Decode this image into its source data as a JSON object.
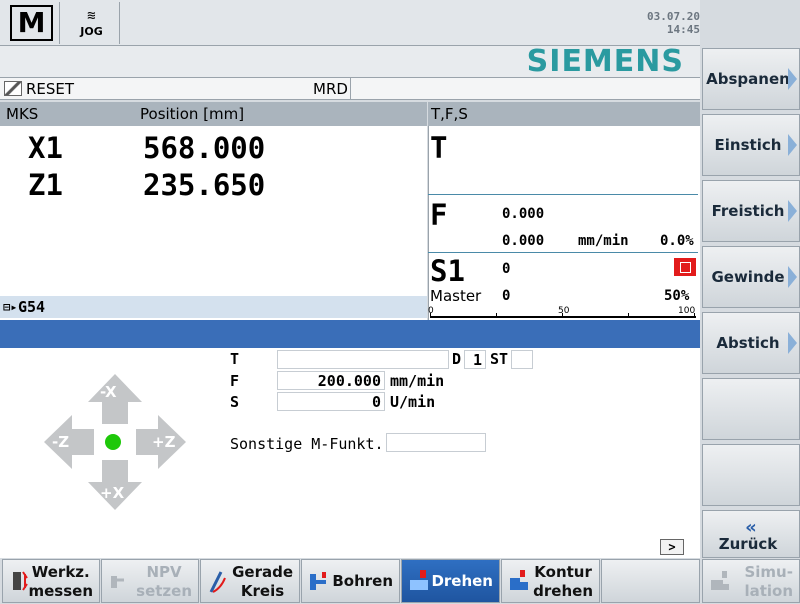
{
  "header": {
    "mode_icon": "M",
    "jog_label": "JOG",
    "date": "03.07.20",
    "time": "14:45",
    "brand": "SIEMENS"
  },
  "status": {
    "reset": "RESET",
    "mrd": "MRD"
  },
  "position": {
    "col_system": "MKS",
    "col_position": "Position [mm]",
    "axes": [
      {
        "name": "X1",
        "value": "568.000"
      },
      {
        "name": "Z1",
        "value": "235.650"
      }
    ],
    "frame": "G54"
  },
  "tfs": {
    "title": "T,F,S",
    "t_label": "T",
    "f_label": "F",
    "f_value1": "0.000",
    "f_value2": "0.000",
    "f_unit": "mm/min",
    "f_percent": "0.0%",
    "s_label": "S1",
    "s_value": "0",
    "master_label": "Master",
    "master_value": "0",
    "s_percent": "50%",
    "scale_0": "0",
    "scale_50": "50",
    "scale_100": "100",
    "colors": {
      "spindle_icon": "#e21b1b"
    }
  },
  "jog": {
    "minus_x": "-X",
    "plus_x": "+X",
    "minus_z": "-Z",
    "plus_z": "+Z",
    "t_label": "T",
    "t_value": "",
    "d_label": "D",
    "d_value": "1",
    "st_label": "ST",
    "st_value": "",
    "f_label": "F",
    "f_value": "200.000",
    "f_unit": "mm/min",
    "s_label": "S",
    "s_value": "0",
    "s_unit": "U/min",
    "m_label": "Sonstige M-Funkt.",
    "m_value": "",
    "more": ">"
  },
  "softkeys_right": [
    "Abspanen",
    "Einstich",
    "Freistich",
    "Gewinde",
    "Abstich",
    "",
    "",
    "Zurück"
  ],
  "softkeys_bottom": [
    {
      "l1": "Werkz.",
      "l2": "messen"
    },
    {
      "l1": "NPV",
      "l2": "setzen"
    },
    {
      "l1": "Gerade",
      "l2": "Kreis"
    },
    {
      "l1": "Bohren",
      "l2": ""
    },
    {
      "l1": "Drehen",
      "l2": ""
    },
    {
      "l1": "Kontur",
      "l2": "drehen"
    },
    {
      "l1": "",
      "l2": ""
    },
    {
      "l1": "Simu-",
      "l2": "lation"
    }
  ]
}
